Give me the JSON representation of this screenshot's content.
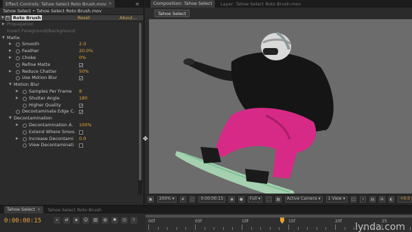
{
  "effect_controls": {
    "tab_title": "Effect Controls: Tahoe Select Roto Brush.mov",
    "subheader": "Tahoe Select • Tahoe Select Roto Brush.mov",
    "effect": {
      "badge": "fx",
      "name": "Roto Brush",
      "reset": "Reset",
      "about": "About..."
    },
    "properties": [
      {
        "label": "Propagation",
        "indent": 1,
        "arrow": "▶",
        "dim": true
      },
      {
        "label": "Invert Foreground/Background",
        "indent": 1,
        "dim": true
      },
      {
        "label": "Matte",
        "indent": 1,
        "arrow": "▼"
      },
      {
        "label": "Smooth",
        "indent": 2,
        "arrow": "▶",
        "stopwatch": true,
        "value": "2.0"
      },
      {
        "label": "Feather",
        "indent": 2,
        "arrow": "▶",
        "stopwatch": true,
        "value": "20.0%"
      },
      {
        "label": "Choke",
        "indent": 2,
        "arrow": "▶",
        "stopwatch": true,
        "value": "0%"
      },
      {
        "label": "Refine Matte",
        "indent": 2,
        "stopwatch": true,
        "check": true
      },
      {
        "label": "Reduce Chatter",
        "indent": 2,
        "arrow": "▶",
        "stopwatch": true,
        "value": "50%"
      },
      {
        "label": "Use Motion Blur",
        "indent": 2,
        "stopwatch": true,
        "check": true
      },
      {
        "label": "Motion Blur",
        "indent": 2,
        "arrow": "▼"
      },
      {
        "label": "Samples Per Frame",
        "indent": 3,
        "arrow": "▶",
        "stopwatch": true,
        "value": "8"
      },
      {
        "label": "Shutter Angle",
        "indent": 3,
        "arrow": "▶",
        "stopwatch": true,
        "value": "180"
      },
      {
        "label": "Higher Quality",
        "indent": 3,
        "stopwatch": true,
        "check": true
      },
      {
        "label": "Decontaminate Edge C.",
        "indent": 2,
        "stopwatch": true,
        "check": true
      },
      {
        "label": "Decontamination",
        "indent": 2,
        "arrow": "▼"
      },
      {
        "label": "Decontamination A.",
        "indent": 3,
        "arrow": "▶",
        "stopwatch": true,
        "value": "100%"
      },
      {
        "label": "Extend Where Smoo.",
        "indent": 3,
        "stopwatch": true,
        "check": false
      },
      {
        "label": "Increase Decontami",
        "indent": 3,
        "arrow": "▶",
        "stopwatch": true,
        "value": "0.0"
      },
      {
        "label": "View Decontaminati",
        "indent": 3,
        "stopwatch": true,
        "check": false
      }
    ]
  },
  "composition": {
    "tab_title": "Composition: Tahoe Select",
    "layer_tab": "Layer: Tahoe Select Roto Brush.mov",
    "breadcrumb": "Tahoe Select",
    "bottom_bar": {
      "zoom": "200%",
      "timecode": "0:00:00:15",
      "resolution": "Full",
      "camera": "Active Camera",
      "views": "1 View",
      "exposure": "+0.0"
    }
  },
  "timeline": {
    "tabs": [
      "Tahoe Select",
      "Tahoe Select Roto Brush"
    ],
    "timecode": "0:00:00:15",
    "ruler_labels": [
      "00f",
      "05f",
      "10f",
      "15f",
      "20f",
      "25"
    ],
    "watermark": "lynda.com"
  },
  "colors": {
    "accent_orange": "#e5a338",
    "panel_bg": "#2b2b2b",
    "viewer_bg": "#6c6c6c",
    "playhead": "#e6a32a"
  }
}
